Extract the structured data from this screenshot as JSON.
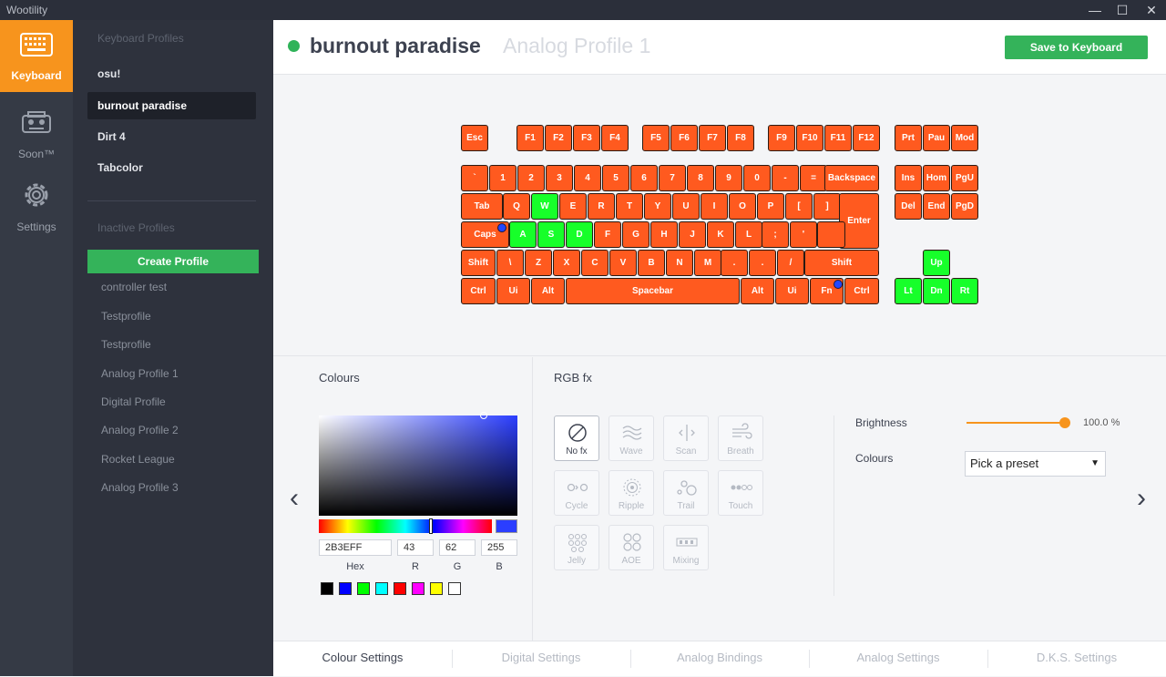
{
  "app": {
    "title": "Wootility"
  },
  "window_controls": {
    "minimize": "—",
    "maximize": "☐",
    "close": "✕"
  },
  "nav": [
    {
      "label": "Keyboard",
      "icon": "keyboard-icon",
      "active": true
    },
    {
      "label": "Soon™",
      "icon": "robot-icon",
      "active": false
    },
    {
      "label": "Settings",
      "icon": "gear-icon",
      "active": false
    }
  ],
  "profiles": {
    "keyboard_title": "Keyboard Profiles",
    "keyboard_profiles": [
      "osu!",
      "burnout paradise",
      "Dirt 4",
      "Tabcolor"
    ],
    "active_profile": "burnout paradise",
    "inactive_title": "Inactive Profiles",
    "create_label": "Create Profile",
    "inactive_profiles": [
      "controller test",
      "Testprofile",
      "Testprofile",
      "Analog Profile 1",
      "Digital Profile",
      "Analog Profile 2",
      "Rocket League",
      "Analog Profile 3"
    ]
  },
  "header": {
    "profile_name": "burnout paradise",
    "profile_sub": "Analog Profile 1",
    "save_label": "Save to Keyboard",
    "status_color": "#2fb359"
  },
  "keyboard": {
    "key_color": "#ff5a1f",
    "highlight_color": "#17ff2a",
    "rows": [
      [
        "Esc",
        "F1",
        "F2",
        "F3",
        "F4",
        "F5",
        "F6",
        "F7",
        "F8",
        "F9",
        "F10",
        "F11",
        "F12",
        "Prt",
        "Pau",
        "Mod"
      ],
      [
        "`",
        "1",
        "2",
        "3",
        "4",
        "5",
        "6",
        "7",
        "8",
        "9",
        "0",
        "-",
        "=",
        "Backspace",
        "Ins",
        "Hom",
        "PgU"
      ],
      [
        "Tab",
        "Q",
        "W",
        "E",
        "R",
        "T",
        "Y",
        "U",
        "I",
        "O",
        "P",
        "[",
        "]",
        "Enter",
        "Del",
        "End",
        "PgD"
      ],
      [
        "Caps",
        "A",
        "S",
        "D",
        "F",
        "G",
        "H",
        "J",
        "K",
        "L",
        ";",
        "'",
        ""
      ],
      [
        "Shift",
        "\\",
        "Z",
        "X",
        "C",
        "V",
        "B",
        "N",
        "M",
        ".",
        ".",
        "/",
        "Shift",
        "Up"
      ],
      [
        "Ctrl",
        "Ui",
        "Alt",
        "Spacebar",
        "Alt",
        "Ui",
        "Fn",
        "Ctrl",
        "Lt",
        "Dn",
        "Rt"
      ]
    ],
    "highlighted": [
      "W",
      "A",
      "S",
      "D",
      "Up",
      "Lt",
      "Dn",
      "Rt"
    ]
  },
  "colours": {
    "title": "Colours",
    "hex": "2B3EFF",
    "r": "43",
    "g": "62",
    "b": "255",
    "labels": {
      "hex": "Hex",
      "r": "R",
      "g": "G",
      "b": "B"
    },
    "current": "#2b3eff",
    "palette": [
      "#000000",
      "#0000ff",
      "#00ff00",
      "#00ffff",
      "#ff0000",
      "#ff00ff",
      "#ffff00",
      "#ffffff"
    ]
  },
  "rgbfx": {
    "title": "RGB fx",
    "effects": [
      {
        "label": "No fx",
        "icon": "no-fx-icon",
        "active": true
      },
      {
        "label": "Wave",
        "icon": "wave-icon",
        "active": false
      },
      {
        "label": "Scan",
        "icon": "scan-icon",
        "active": false
      },
      {
        "label": "Breath",
        "icon": "breath-icon",
        "active": false
      },
      {
        "label": "Cycle",
        "icon": "cycle-icon",
        "active": false
      },
      {
        "label": "Ripple",
        "icon": "ripple-icon",
        "active": false
      },
      {
        "label": "Trail",
        "icon": "trail-icon",
        "active": false
      },
      {
        "label": "Touch",
        "icon": "touch-icon",
        "active": false
      },
      {
        "label": "Jelly",
        "icon": "jelly-icon",
        "active": false
      },
      {
        "label": "AOE",
        "icon": "aoe-icon",
        "active": false
      },
      {
        "label": "Mixing",
        "icon": "mixing-icon",
        "active": false
      }
    ],
    "brightness_label": "Brightness",
    "brightness_value": "100.0 %",
    "brightness_fraction": 1.0,
    "colours_label": "Colours",
    "preset_value": "Pick a preset"
  },
  "tabs": [
    {
      "label": "Colour Settings",
      "active": true
    },
    {
      "label": "Digital Settings",
      "active": false
    },
    {
      "label": "Analog Bindings",
      "active": false
    },
    {
      "label": "Analog Settings",
      "active": false
    },
    {
      "label": "D.K.S. Settings",
      "active": false
    }
  ]
}
